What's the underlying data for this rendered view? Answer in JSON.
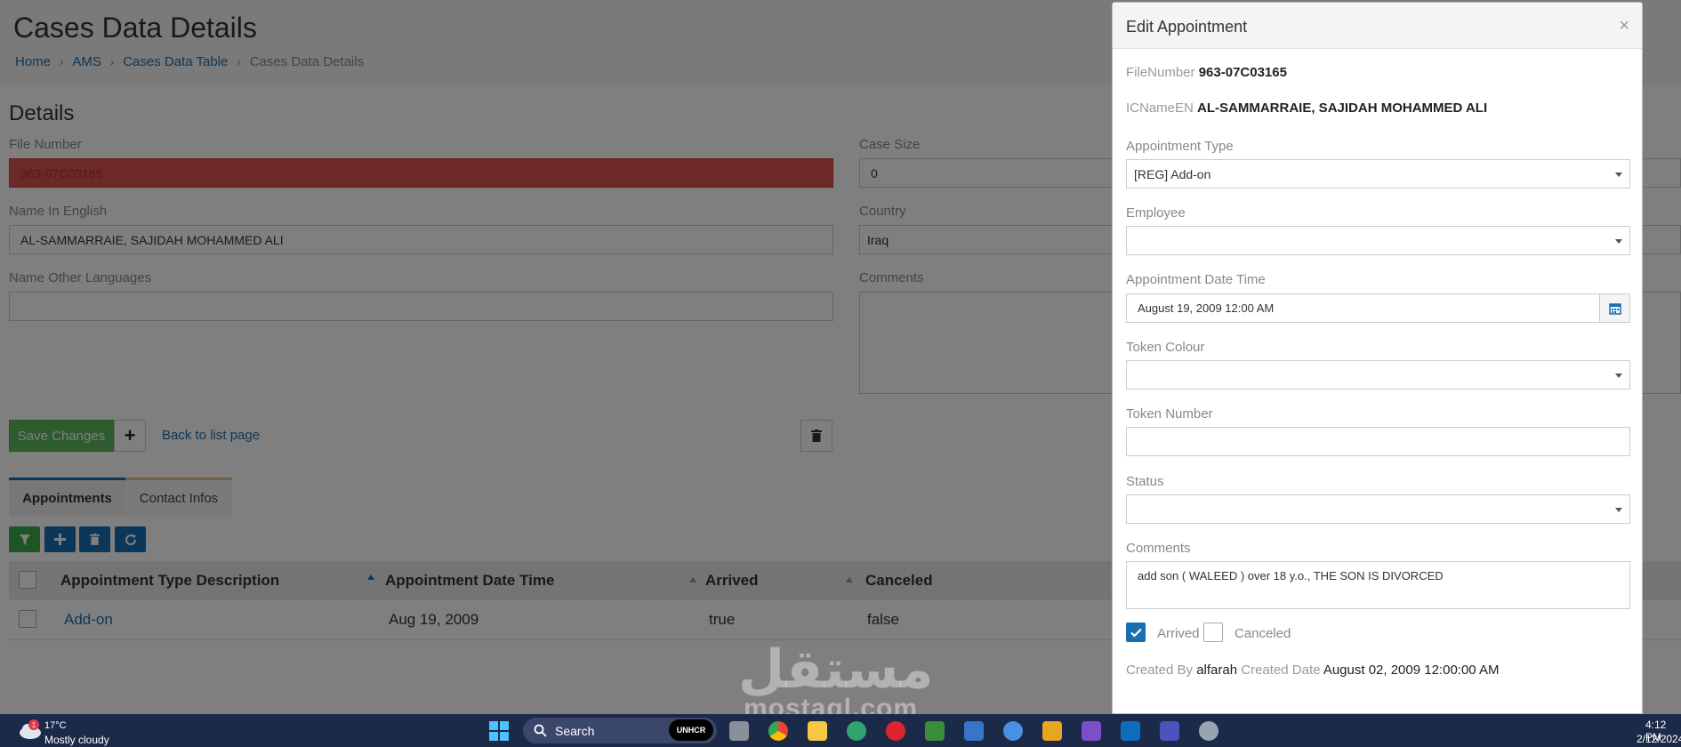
{
  "page": {
    "title": "Cases Data Details",
    "breadcrumb": [
      "Home",
      "AMS",
      "Cases Data Table",
      "Cases Data Details"
    ],
    "details_title": "Details",
    "fields": {
      "file_number_label": "File Number",
      "file_number_value": "963-07C03165",
      "case_size_label": "Case Size",
      "case_size_value": "0",
      "name_english_label": "Name In English",
      "name_english_value": "AL-SAMMARRAIE, SAJIDAH MOHAMMED ALI",
      "country_label": "Country",
      "country_value": "Iraq",
      "name_other_label": "Name Other Languages",
      "name_other_value": "",
      "comments_label": "Comments"
    },
    "actions": {
      "save_label": "Save Changes",
      "add_label": "+",
      "back_label": "Back to list page"
    },
    "tabs": [
      {
        "label": "Appointments",
        "active": true
      },
      {
        "label": "Contact Infos",
        "active": false
      }
    ],
    "grid": {
      "columns": [
        "Appointment Type Description",
        "Appointment Date Time",
        "Arrived",
        "Canceled"
      ],
      "rows": [
        {
          "type": "Add-on",
          "datetime": "Aug 19, 2009",
          "arrived": "true",
          "canceled": "false"
        }
      ],
      "overflow": "..."
    }
  },
  "modal": {
    "title": "Edit Appointment",
    "close": "×",
    "file_number_label": "FileNumber",
    "file_number_value": "963-07C03165",
    "icname_label": "ICNameEN",
    "icname_value": "AL-SAMMARRAIE, SAJIDAH MOHAMMED ALI",
    "appointment_type_label": "Appointment Type",
    "appointment_type_value": "[REG] Add-on",
    "employee_label": "Employee",
    "employee_value": "",
    "datetime_label": "Appointment Date Time",
    "datetime_value": "August 19, 2009 12:00 AM",
    "token_colour_label": "Token Colour",
    "token_colour_value": "",
    "token_number_label": "Token Number",
    "token_number_value": "",
    "status_label": "Status",
    "status_value": "",
    "comments_label": "Comments",
    "comments_value": "add son ( WALEED ) over 18 y.o., THE SON IS DIVORCED",
    "arrived_label": "Arrived",
    "arrived_checked": true,
    "canceled_label": "Canceled",
    "canceled_checked": false,
    "created_by_label": "Created By",
    "created_by_value": "alfarah",
    "created_date_label": "Created Date",
    "created_date_value": "August 02, 2009 12:00:00 AM"
  },
  "watermark": {
    "arabic": "مستقل",
    "latin": "mostaql.com"
  },
  "taskbar": {
    "weather_badge": "1",
    "temperature": "17°C",
    "weather": "Mostly cloudy",
    "search_label": "Search",
    "unhcr_label": "UNHCR",
    "time": "4:12 PM",
    "date": "2/12/2024"
  },
  "colors": {
    "accent_blue": "#1a6fb0",
    "success_green": "#5cb85c",
    "error_red": "#d9534f",
    "taskbar_bg": "#1c2a4a"
  }
}
